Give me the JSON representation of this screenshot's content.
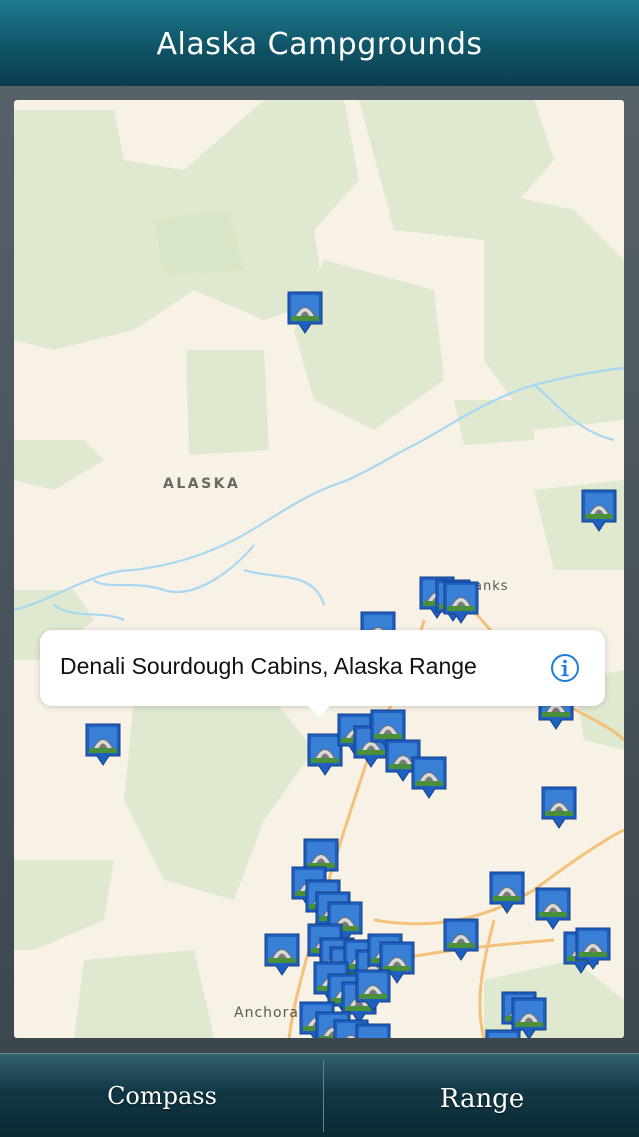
{
  "navbar": {
    "title": "Alaska Campgrounds"
  },
  "map": {
    "labels": {
      "region": "ALASKA",
      "city_fairbanks": "anks",
      "city_anchorage": "Anchora"
    },
    "colors": {
      "land": "#f7f1e6",
      "forest": "#dfe9cf",
      "water": "#a7d8f0",
      "road": "#f3c27a"
    },
    "pin_icon": "campground-marker-icon"
  },
  "callout": {
    "text": "Denali Sourdough Cabins, Alaska Range",
    "info_icon": "info-icon"
  },
  "toolbar": {
    "compass_label": "Compass",
    "range_label": "Range"
  }
}
